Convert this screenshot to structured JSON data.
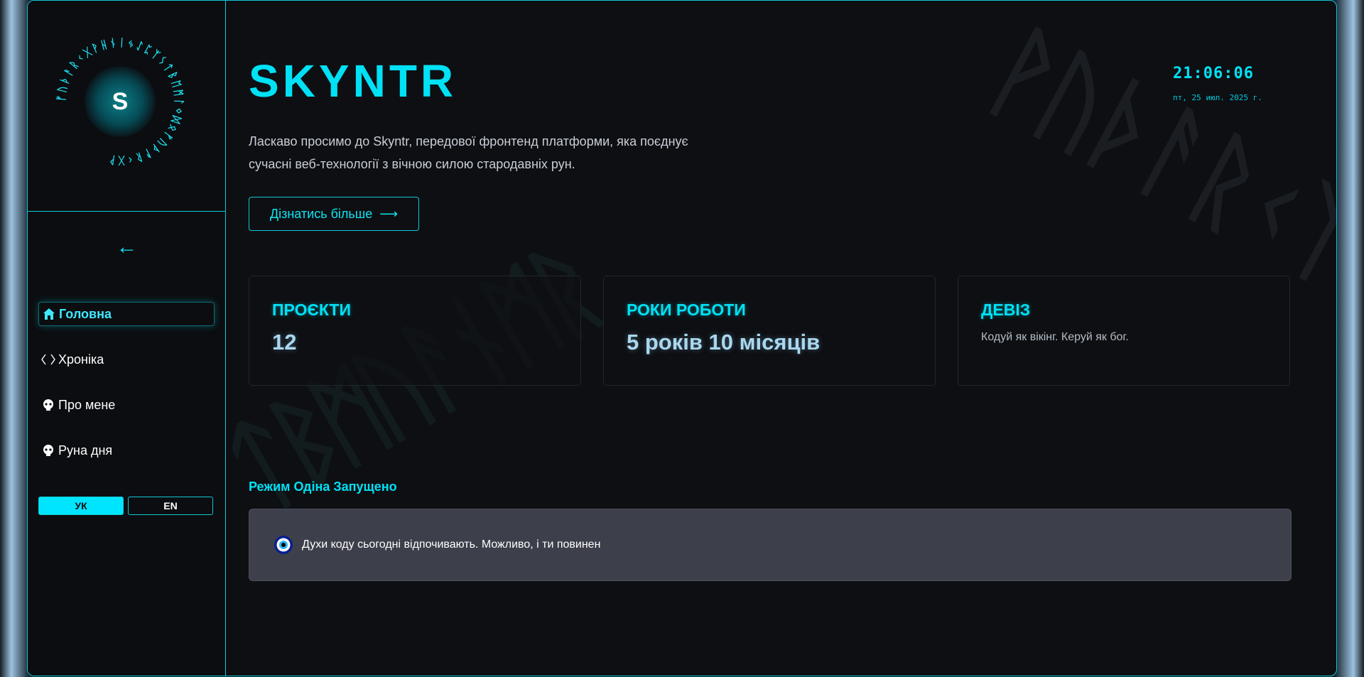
{
  "brand": {
    "letter": "S",
    "ring_runes": "ᚠᚢᚦᚨᚱᚲᚷᚹᚺᚾᛁᛃᛇᛈᛉᛊᛏᛒᛖᛗᛚᛜᛞᛟᚠᚢᚦᚨᚱᚲᚷᚹ"
  },
  "sidebar": {
    "collapse_icon": "←",
    "items": [
      {
        "label": "Головна",
        "icon": "home-icon",
        "active": true
      },
      {
        "label": "Хроніка",
        "icon": "code-icon",
        "active": false
      },
      {
        "label": "Про мене",
        "icon": "skull-icon",
        "active": false
      },
      {
        "label": "Руна дня",
        "icon": "skull-icon",
        "active": false
      }
    ],
    "languages": [
      "УК",
      "EN"
    ],
    "active_language": "УК"
  },
  "header": {
    "title": "SKYNTR",
    "time": "21:06:06",
    "date": "пт, 25 июл. 2025 г."
  },
  "intro": {
    "text": "Ласкаво просимо до Skyntr, передової фронтенд платформи, яка поєднує сучасні веб-технології з вічною силою стародавніх рун.",
    "cta_label": "Дізнатись більше",
    "cta_arrow": "⟶"
  },
  "stats": [
    {
      "title": "ПРОЄКТИ",
      "value": "12"
    },
    {
      "title": "РОКИ РОБОТИ",
      "value": "5 років 10 місяців"
    },
    {
      "title": "ДЕВІЗ",
      "value": "Кодуй як вікінг. Керуй як бог."
    }
  ],
  "odin": {
    "label": "Режим Одіна Запущено",
    "message": "Духи коду сьогодні відпочивають. Можливо, і ти повинен"
  },
  "watermarks": {
    "top_right": "ᚹᚢᚦᚨᚱᚲᛉ",
    "center": "ᛏᛒᛗᚢᚨᚾᛗᚱ"
  },
  "colors": {
    "accent": "#00e1f5",
    "background": "#0d0f13",
    "border": "#10c8d6",
    "notice_bg": "#3d404b"
  }
}
